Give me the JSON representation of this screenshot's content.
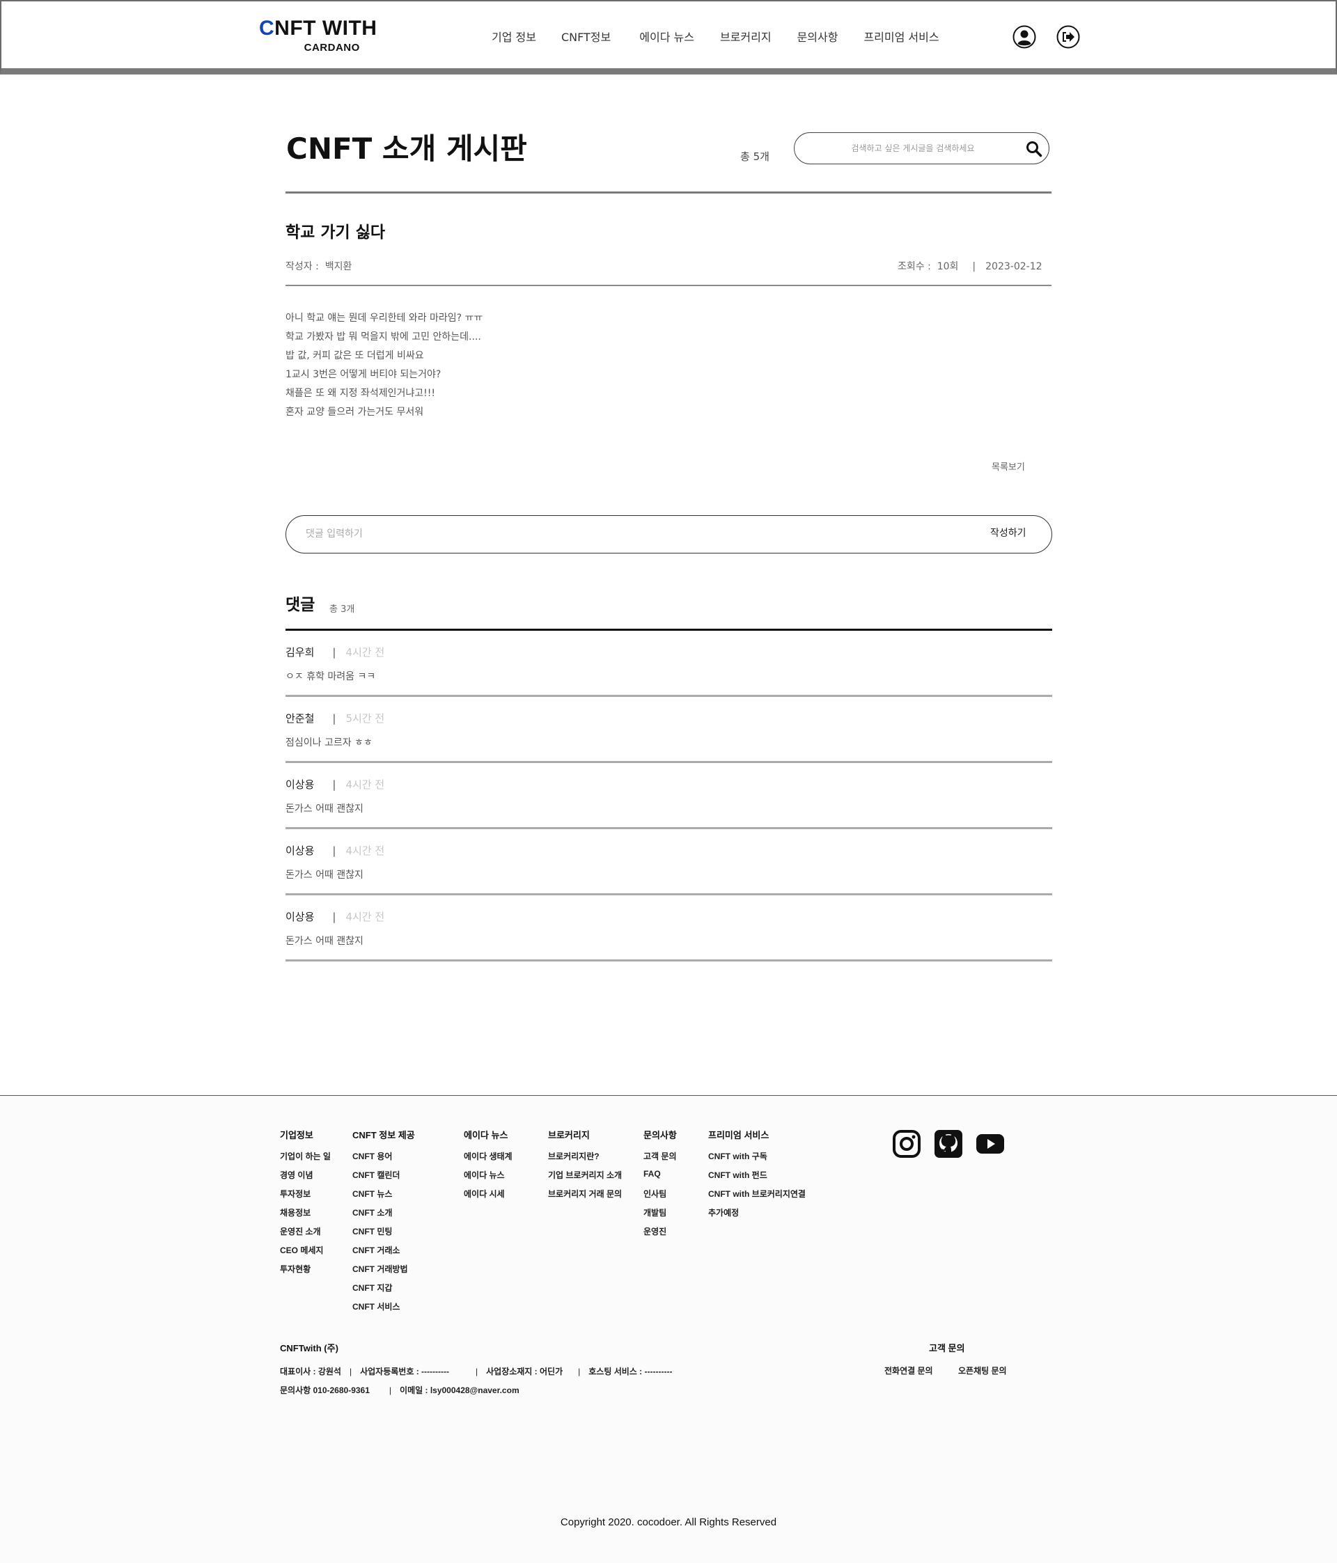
{
  "header": {
    "logo_first_letter": "C",
    "logo_rest": "NFT WITH",
    "logo_sub": "CARDANO",
    "nav": [
      "기업 정보",
      "CNFT정보",
      "에이다 뉴스",
      "브로커리지",
      "문의사항",
      "프리미엄 서비스"
    ],
    "icons": [
      "user-circle-icon",
      "logout-icon"
    ]
  },
  "board": {
    "title": "CNFT 소개 게시판",
    "total": "총 5개",
    "search_placeholder": "검색하고 싶은 게시글을 검색하세요",
    "search_icon": "search-icon"
  },
  "post": {
    "title": "학교 가기 싫다",
    "author_label": "작성자 :",
    "author": "백지환",
    "views_label": "조회수 :",
    "views": "10회",
    "date": "2023-02-12",
    "body": [
      "아니 학교 얘는 뭔데 우리한테 와라 마라임? ㅠㅠ",
      "학교 가봤자 밥 뭐 먹을지 밖에 고민 안하는데....",
      "밥 값, 커피 값은 또 더럽게 비싸요",
      "1교시 3번은 어떻게 버티야 되는거야?",
      "채플은 또 왜 지정 좌석제인거냐고!!!",
      "혼자 교양 들으러 가는거도 무서워"
    ],
    "list_link": "목록보기"
  },
  "comment_form": {
    "placeholder": "댓글 입력하기",
    "submit": "작성하기"
  },
  "comments": {
    "heading": "댓글",
    "count": "총 3개",
    "items": [
      {
        "author": "김우희",
        "time": "4시간 전",
        "text": "ㅇㅈ 휴학 마려움 ㅋㅋ"
      },
      {
        "author": "안준철",
        "time": "5시간 전",
        "text": "점심이나 고르자 ㅎㅎ"
      },
      {
        "author": "이상용",
        "time": "4시간 전",
        "text": "돈가스 어때 괜찮지"
      },
      {
        "author": "이상용",
        "time": "4시간 전",
        "text": "돈가스 어때 괜찮지"
      },
      {
        "author": "이상용",
        "time": "4시간 전",
        "text": "돈가스 어때 괜찮지"
      }
    ]
  },
  "footer": {
    "columns": [
      {
        "title": "기업정보",
        "items": [
          "기업이 하는 일",
          "경영 이념",
          "투자정보",
          "채용정보",
          "운영진 소개",
          "CEO 메세지",
          "투자현황"
        ]
      },
      {
        "title": "CNFT 정보 제공",
        "items": [
          "CNFT 용어",
          "CNFT 캘린더",
          "CNFT 뉴스",
          "CNFT 소개",
          "CNFT 민팅",
          "CNFT 거래소",
          "CNFT 거래방법",
          "CNFT 지갑",
          "CNFT 서비스"
        ]
      },
      {
        "title": "에이다 뉴스",
        "items": [
          "에이다 생태계",
          "에이다 뉴스",
          "에이다 시세"
        ]
      },
      {
        "title": "브로커리지",
        "items": [
          "브로커리지란?",
          "기업 브로커리지 소개",
          "브로커리지 거래 문의"
        ]
      },
      {
        "title": "문의사항",
        "items": [
          "고객 문의",
          "FAQ",
          "인사팀",
          "개발팀",
          "운영진"
        ]
      },
      {
        "title": "프리미엄 서비스",
        "items": [
          "CNFT with 구독",
          "CNFT with 펀드",
          "CNFT with 브로커리지연결",
          "추가예정"
        ]
      }
    ],
    "social": [
      "instagram-icon",
      "github-icon",
      "youtube-icon"
    ],
    "company": "CNFTwith (주)",
    "info_line1": [
      "대표이사 : 강원석",
      "사업자등록번호 : ----------",
      "사업장소재지 : 어딘가",
      "호스팅 서비스 : ----------"
    ],
    "info_line2": [
      "문의사항  010-2680-9361",
      "이메일 : lsy000428@naver.com"
    ],
    "cs_title": "고객 문의",
    "cs_links": [
      "전화연결 문의",
      "오픈채팅 문의"
    ],
    "copyright": "Copyright 2020. cocodoer. All Rights Reserved"
  },
  "colors": {
    "logo_accent": "#1144b8",
    "header_border": "#7a7a7a",
    "comment_time": "#c6c6c6"
  }
}
